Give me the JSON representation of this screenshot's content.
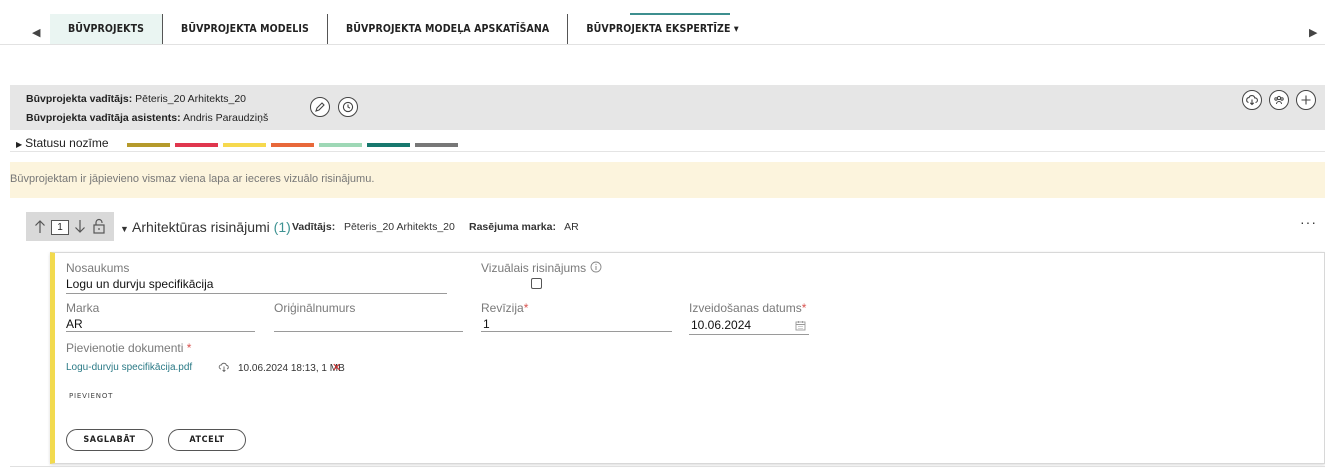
{
  "tabs": [
    {
      "label": "BŪVPROJEKTS",
      "active": true
    },
    {
      "label": "BŪVPROJEKTA MODELIS",
      "active": false
    },
    {
      "label": "BŪVPROJEKTA MODEĻA APSKATĪŠANA",
      "active": false
    },
    {
      "label": "BŪVPROJEKTA EKSPERTĪZE ▾",
      "active": false
    }
  ],
  "nav": {
    "prev": "◀",
    "next": "▶"
  },
  "project": {
    "manager_label": "Būvprojekta vadītājs:",
    "manager_value": "Pēteris_20 Arhitekts_20",
    "assistant_label": "Būvprojekta vadītāja asistents:",
    "assistant_value": "Andris Paraudziņš"
  },
  "status_legend": {
    "label": "Statusu nozīme",
    "colors": [
      "#b59a2b",
      "#e0364e",
      "#f6d94e",
      "#e8683a",
      "#9ed8b6",
      "#17786e",
      "#777777"
    ]
  },
  "warning": {
    "text": "Būvprojektam ir jāpievieno vismaz viena lapa ar ieceres vizuālo risinājumu."
  },
  "section": {
    "order": "1",
    "title": "Arhitektūras risinājumi",
    "count": "(1)",
    "manager_label": "Vadītājs:",
    "manager_value": "Pēteris_20 Arhitekts_20",
    "mark_label": "Rasējuma marka:",
    "mark_value": "AR",
    "menu": "···"
  },
  "form": {
    "name_label": "Nosaukums",
    "name_value": "Logu un durvju specifikācija",
    "visual_label": "Vizuālais risinājums",
    "visual_checked": false,
    "mark_label": "Marka",
    "mark_value": "AR",
    "original_label": "Oriģinālnumurs",
    "original_value": "",
    "revision_label": "Revīzija",
    "revision_value": "1",
    "created_label": "Izveidošanas datums",
    "created_value": "10.06.2024",
    "required_mark": "*",
    "docs_label": "Pievienotie dokumenti",
    "documents": [
      {
        "name": "Logu-durvju specifikācija.pdf",
        "meta": "10.06.2024 18:13, 1 MB",
        "remove": "✕"
      }
    ],
    "add_label": "PIEVIENOT",
    "save_label": "SAGLABĀT",
    "cancel_label": "ATCELT"
  }
}
